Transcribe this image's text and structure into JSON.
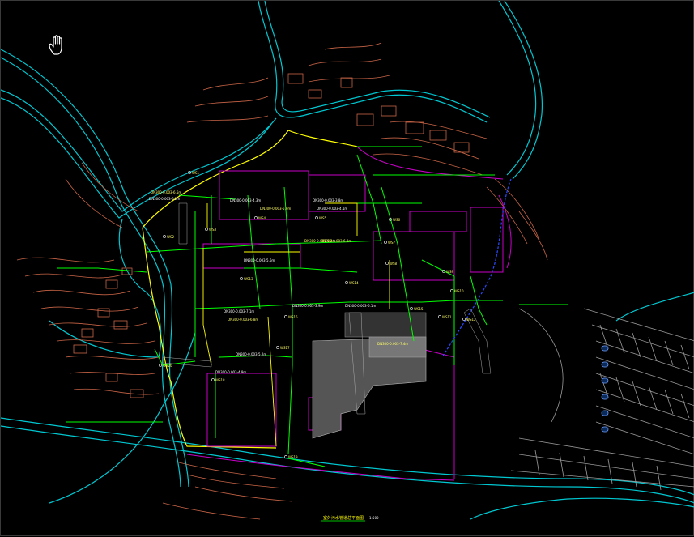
{
  "drawing": {
    "title": "室外污水管道总平面图",
    "scale": "1:500"
  },
  "tools": {
    "pan_icon": "hand-pan-icon"
  },
  "colors": {
    "background": "#000000",
    "road": "#00c8d2",
    "terrain": "#c86446",
    "building": "#c800c8",
    "pipe_green": "#00ff00",
    "pipe_yellow": "#ffff00",
    "parking": "#9a9a9a"
  },
  "pipe_labels": [
    "DN300-0.003-6.5m",
    "DN300-0.003-6.2m",
    "DN300-0.003-4.3m",
    "DN300-0.003-5.9m",
    "DN300-0.003-3.8m",
    "DN300-0.003-4.1m",
    "DN300-0.003-6.3m",
    "DN300-0.003-5.6m",
    "DN300-0.003-7.1m",
    "DN300-0.003-6.8m",
    "DN300-0.003-5.2m",
    "DN300-0.003-4.9m",
    "DN300-0.003-5.4m",
    "DN300-0.003-3.9m",
    "DN300-0.003-6.1m",
    "DN300-0.003-7.4m"
  ],
  "node_labels": [
    "WS1",
    "WS2",
    "WS3",
    "WS4",
    "WS5",
    "WS6",
    "WS7",
    "WS8",
    "WS9",
    "WS10",
    "WS11",
    "WS12",
    "WS13",
    "WS14",
    "WS15",
    "WS16",
    "WS17",
    "WS18",
    "WS19",
    "WS20"
  ]
}
